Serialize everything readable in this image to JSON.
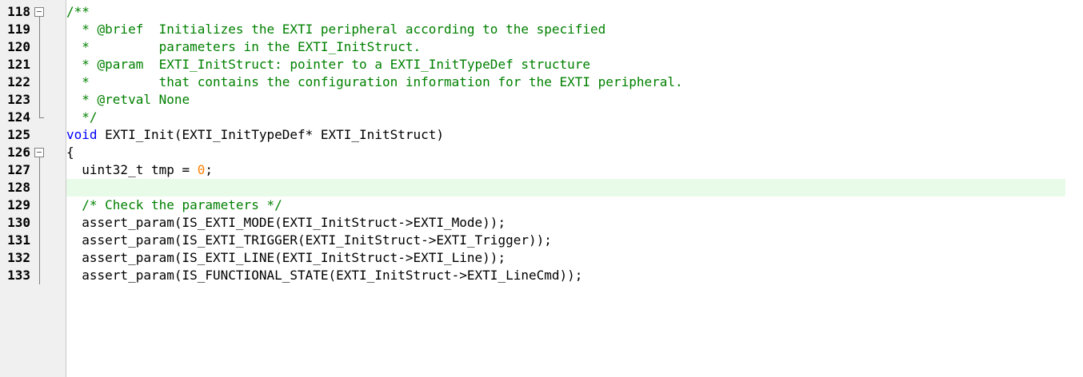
{
  "editor": {
    "lines": [
      {
        "no": "118",
        "fold": "open",
        "segments": [
          {
            "t": "/**",
            "c": "cm"
          }
        ]
      },
      {
        "no": "119",
        "fold": "line",
        "segments": [
          {
            "t": "  * @brief  Initializes the EXTI peripheral according to the specified",
            "c": "cm"
          }
        ]
      },
      {
        "no": "120",
        "fold": "line",
        "segments": [
          {
            "t": "  *         parameters in the EXTI_InitStruct.",
            "c": "cm"
          }
        ]
      },
      {
        "no": "121",
        "fold": "line",
        "segments": [
          {
            "t": "  * @param  EXTI_InitStruct: pointer to a EXTI_InitTypeDef structure",
            "c": "cm"
          }
        ]
      },
      {
        "no": "122",
        "fold": "line",
        "segments": [
          {
            "t": "  *         that contains the configuration information for the EXTI peripheral.",
            "c": "cm"
          }
        ]
      },
      {
        "no": "123",
        "fold": "line",
        "segments": [
          {
            "t": "  * @retval None",
            "c": "cm"
          }
        ]
      },
      {
        "no": "124",
        "fold": "end",
        "segments": [
          {
            "t": "  */",
            "c": "cm"
          }
        ]
      },
      {
        "no": "125",
        "fold": "",
        "segments": [
          {
            "t": "void",
            "c": "kw"
          },
          {
            "t": " EXTI_Init(EXTI_InitTypeDef* EXTI_InitStruct)",
            "c": ""
          }
        ]
      },
      {
        "no": "126",
        "fold": "open",
        "segments": [
          {
            "t": "{",
            "c": ""
          }
        ]
      },
      {
        "no": "127",
        "fold": "line",
        "segments": [
          {
            "t": "  uint32_t tmp = ",
            "c": ""
          },
          {
            "t": "0",
            "c": "num"
          },
          {
            "t": ";",
            "c": ""
          }
        ]
      },
      {
        "no": "128",
        "fold": "line",
        "current": true,
        "segments": [
          {
            "t": "",
            "c": ""
          }
        ]
      },
      {
        "no": "129",
        "fold": "line",
        "segments": [
          {
            "t": "  ",
            "c": ""
          },
          {
            "t": "/* Check the parameters */",
            "c": "cm"
          }
        ]
      },
      {
        "no": "130",
        "fold": "line",
        "segments": [
          {
            "t": "  assert_param(IS_EXTI_MODE(EXTI_InitStruct->EXTI_Mode));",
            "c": ""
          }
        ]
      },
      {
        "no": "131",
        "fold": "line",
        "segments": [
          {
            "t": "  assert_param(IS_EXTI_TRIGGER(EXTI_InitStruct->EXTI_Trigger));",
            "c": ""
          }
        ]
      },
      {
        "no": "132",
        "fold": "line",
        "segments": [
          {
            "t": "  assert_param(IS_EXTI_LINE(EXTI_InitStruct->EXTI_Line));",
            "c": ""
          }
        ]
      },
      {
        "no": "133",
        "fold": "line",
        "segments": [
          {
            "t": "  assert_param(IS_FUNCTIONAL_STATE(EXTI_InitStruct->EXTI_LineCmd));",
            "c": ""
          }
        ]
      }
    ]
  },
  "colors": {
    "comment": "#008000",
    "keyword": "#0000ff",
    "number": "#ff8000",
    "current_line": "#e8fbe8",
    "gutter_bg": "#f0f0f0"
  },
  "icons": {
    "fold_open": "fold-minus-icon",
    "fold_line": "fold-line-icon",
    "fold_end": "fold-end-icon"
  }
}
